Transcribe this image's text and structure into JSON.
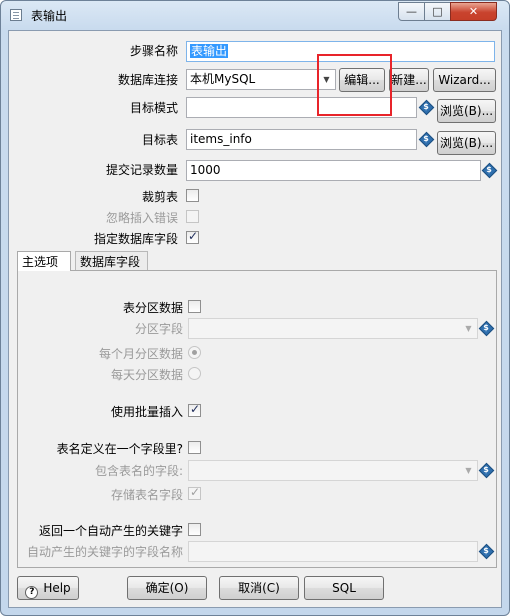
{
  "window": {
    "title": "表输出",
    "min_glyph": "—",
    "max_glyph": "□",
    "close_glyph": "✕"
  },
  "form": {
    "step_name_label": "步骤名称",
    "step_name_value": "表输出",
    "db_conn_label": "数据库连接",
    "db_conn_value": "本机MySQL",
    "edit_button": "编辑...",
    "new_button": "新建...",
    "wizard_button": "Wizard...",
    "target_schema_label": "目标模式",
    "target_schema_value": "",
    "browse_button": "浏览(B)...",
    "target_table_label": "目标表",
    "target_table_value": "items_info",
    "commit_size_label": "提交记录数量",
    "commit_size_value": "1000",
    "truncate_label": "裁剪表",
    "truncate_checked": false,
    "ignore_errors_label": "忽略插入错误",
    "ignore_errors_checked": false,
    "specify_fields_label": "指定数据库字段",
    "specify_fields_checked": true
  },
  "tabs": {
    "main": "主选项",
    "db_fields": "数据库字段"
  },
  "main_tab": {
    "partition_label": "表分区数据",
    "partition_field_label": "分区字段",
    "monthly_label": "每个月分区数据",
    "daily_label": "每天分区数据",
    "batch_insert_label": "使用批量插入",
    "batch_insert_checked": true,
    "name_in_field_label": "表名定义在一个字段里?",
    "name_field_label": "包含表名的字段:",
    "store_name_label": "存储表名字段",
    "store_name_checked": true,
    "return_key_label": "返回一个自动产生的关键字",
    "key_field_label": "自动产生的关键字的字段名称"
  },
  "footer": {
    "help": "Help",
    "ok": "确定(O)",
    "cancel": "取消(C)",
    "sql": "SQL"
  },
  "colors": {
    "highlight_box": "#e8242a",
    "selection": "#3399ff"
  }
}
